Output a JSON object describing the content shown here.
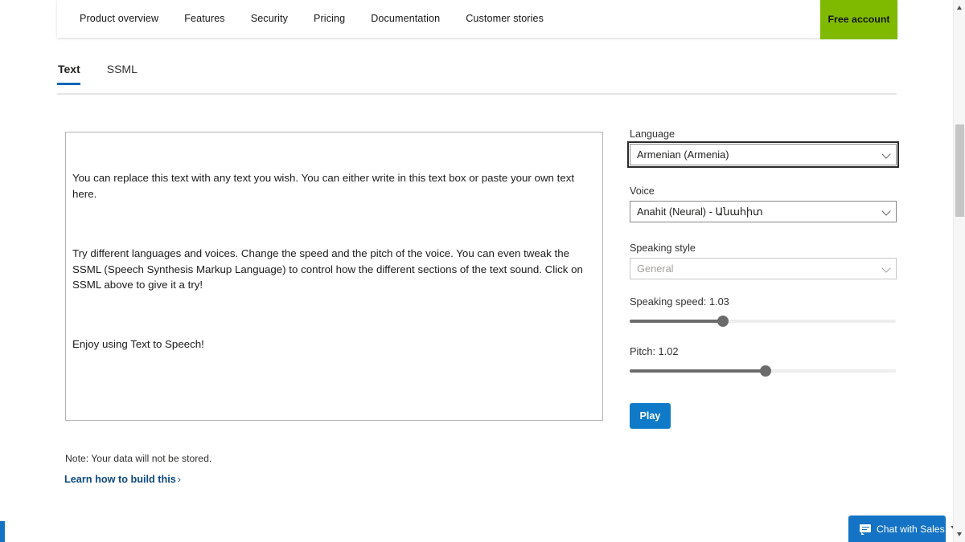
{
  "nav": {
    "links": [
      {
        "label": "Product overview"
      },
      {
        "label": "Features"
      },
      {
        "label": "Security"
      },
      {
        "label": "Pricing"
      },
      {
        "label": "Documentation"
      },
      {
        "label": "Customer stories"
      }
    ],
    "cta": {
      "label": "Free account",
      "color": "#7FBA00"
    }
  },
  "tabs": [
    {
      "label": "Text",
      "active": true
    },
    {
      "label": "SSML",
      "active": false
    }
  ],
  "editor": {
    "paragraphs": [
      "You can replace this text with any text you wish. You can either write in this text box or paste your own text here.",
      "Try different languages and voices. Change the speed and the pitch of the voice. You can even tweak the SSML (Speech Synthesis Markup Language) to control how the different sections of the text sound. Click on SSML above to give it a try!",
      "Enjoy using Text to Speech!"
    ]
  },
  "footer": {
    "note": "Note: Your data will not be stored.",
    "learn_link": "Learn how to build this",
    "learn_chevron": "›"
  },
  "panel": {
    "language": {
      "label": "Language",
      "value": "Armenian (Armenia)",
      "focused": true
    },
    "voice": {
      "label": "Voice",
      "value": "Anahit (Neural) - Անահիտ"
    },
    "speaking_style": {
      "label": "Speaking style",
      "value": "General",
      "disabled": true
    },
    "speaking_speed": {
      "label": "Speaking speed: 1.03",
      "value": 1.03,
      "percent": 35
    },
    "pitch": {
      "label": "Pitch: 1.02",
      "value": 1.02,
      "percent": 51
    },
    "play_button": {
      "label": "Play",
      "color": "#0f7ac7"
    }
  },
  "chat_widget": {
    "label": "Chat with Sales",
    "color": "#1473c4"
  }
}
